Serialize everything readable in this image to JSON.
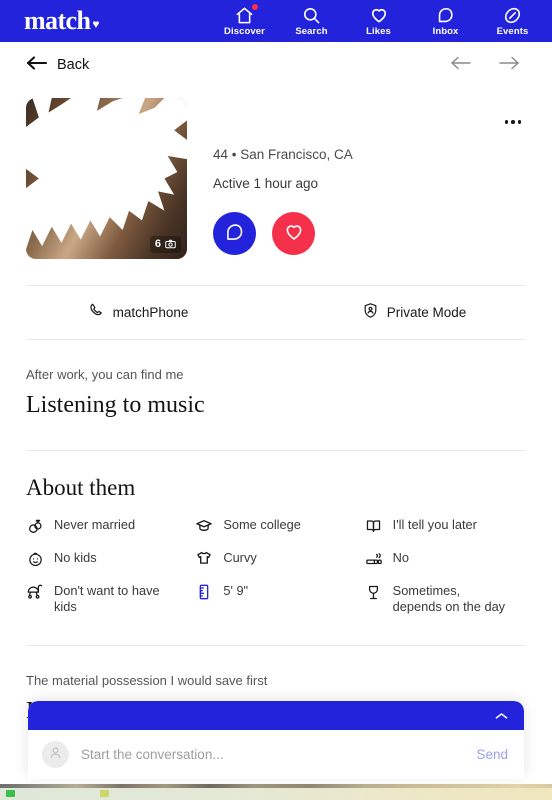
{
  "brand": {
    "logo_text": "match",
    "logo_heart": "♥",
    "accent_blue": "#2323dc",
    "accent_red": "#f5304a",
    "notification_dot": "#ff2d46"
  },
  "topnav": {
    "items": [
      {
        "label": "Discover",
        "icon": "home-icon",
        "has_badge": true
      },
      {
        "label": "Search",
        "icon": "search-icon",
        "has_badge": false
      },
      {
        "label": "Likes",
        "icon": "heart-icon",
        "has_badge": false
      },
      {
        "label": "Inbox",
        "icon": "chat-bubble-icon",
        "has_badge": false
      },
      {
        "label": "Events",
        "icon": "ticket-icon",
        "has_badge": false
      }
    ]
  },
  "backbar": {
    "back_label": "Back",
    "back_icon": "arrow-left-icon",
    "prev_icon": "arrow-left-icon",
    "next_icon": "arrow-right-icon"
  },
  "profile": {
    "name": "",
    "age_location": "44 • San Francisco, CA",
    "activity": "Active 1 hour ago",
    "photo_count": "6",
    "photo_count_icon": "camera-icon",
    "chat_button_icon": "chat-bubble-icon",
    "like_button_icon": "heart-icon",
    "overflow_icon": "kebab-menu-icon"
  },
  "features": [
    {
      "label": "matchPhone",
      "icon": "phone-handset-icon"
    },
    {
      "label": "Private Mode",
      "icon": "shield-person-icon"
    }
  ],
  "prompts": [
    {
      "question": "After work, you can find me",
      "answer": "Listening to music"
    },
    {
      "question": "The material possession I would save first",
      "answer": "My passport"
    }
  ],
  "about": {
    "title": "About them",
    "items": [
      {
        "label": "Never married",
        "icon": "rings-icon",
        "color": "#1a1a1a"
      },
      {
        "label": "Some college",
        "icon": "graduation-cap-icon",
        "color": "#1a1a1a"
      },
      {
        "label": "I'll tell you later",
        "icon": "open-book-icon",
        "color": "#1a1a1a"
      },
      {
        "label": "No kids",
        "icon": "baby-face-icon",
        "color": "#1a1a1a"
      },
      {
        "label": "Curvy",
        "icon": "tshirt-icon",
        "color": "#1a1a1a"
      },
      {
        "label": "No",
        "icon": "cigarette-icon",
        "color": "#1a1a1a"
      },
      {
        "label": "Don't want to have kids",
        "icon": "stroller-icon",
        "color": "#1a1a1a"
      },
      {
        "label": "5' 9\"",
        "icon": "ruler-icon",
        "color": "#2323dc"
      },
      {
        "label": "Sometimes, depends on the day",
        "icon": "wine-glass-icon",
        "color": "#1a1a1a"
      }
    ]
  },
  "chat_dock": {
    "collapse_icon": "chevron-up-icon",
    "avatar_icon": "person-icon",
    "input_value": "",
    "input_placeholder": "Start the conversation...",
    "send_label": "Send"
  }
}
